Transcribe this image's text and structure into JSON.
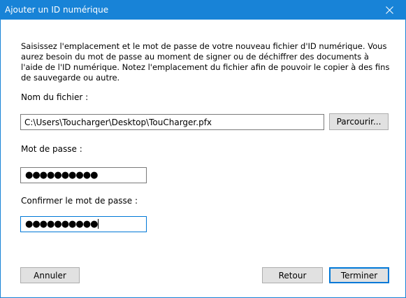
{
  "window": {
    "title": "Ajouter un ID numérique"
  },
  "description": "Saisissez l'emplacement et le mot de passe de votre nouveau fichier d'ID numérique. Vous aurez besoin du mot de passe au moment de signer ou de déchiffrer des documents à l'aide de l'ID numérique. Notez l'emplacement du fichier afin de pouvoir le copier à des fins de sauvegarde ou autre.",
  "file": {
    "label": "Nom du fichier :",
    "value": "C:\\Users\\Toucharger\\Desktop\\TouCharger.pfx",
    "browse_label": "Parcourir..."
  },
  "password": {
    "label": "Mot de passe :",
    "masked": "●●●●●●●●●●"
  },
  "confirm_password": {
    "label": "Confirmer le mot de passe :",
    "masked": "●●●●●●●●●●"
  },
  "buttons": {
    "cancel": "Annuler",
    "back": "Retour",
    "finish": "Terminer"
  },
  "colors": {
    "titlebar": "#1883d7",
    "focus_border": "#0078d7",
    "button_bg": "#e1e1e1"
  },
  "icons": {
    "close": "close-icon"
  }
}
